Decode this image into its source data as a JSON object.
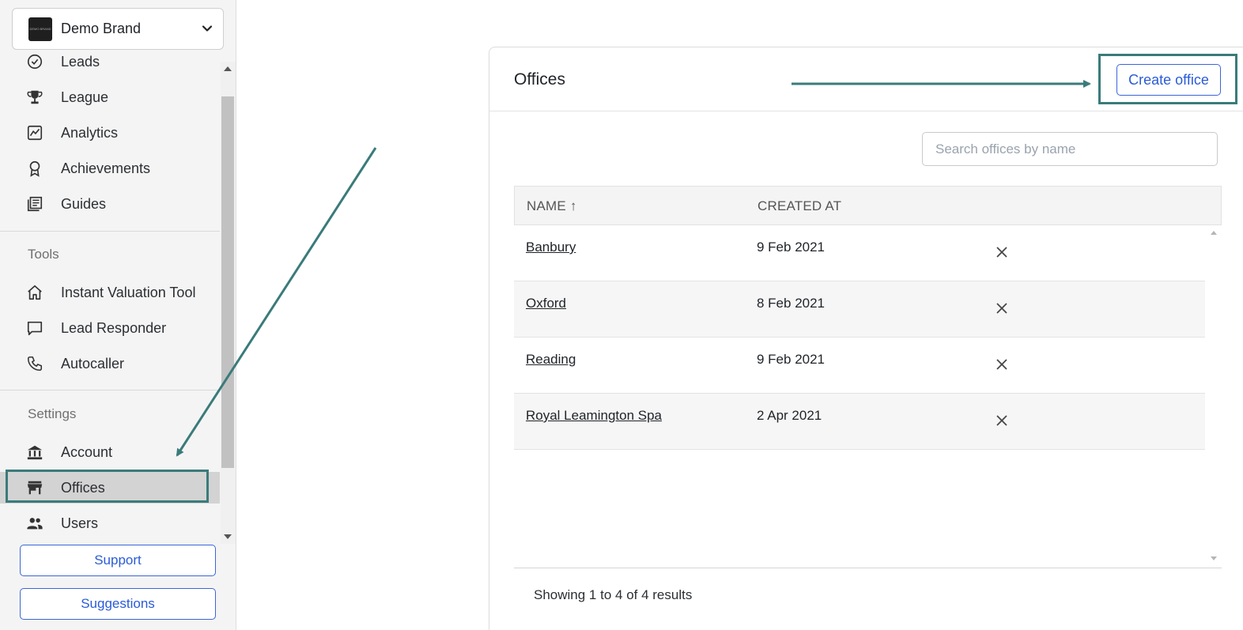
{
  "brand": {
    "name": "Demo Brand",
    "logo_text": "DEMO BRAND"
  },
  "sidebar": {
    "items_top": [
      {
        "label": "Leads",
        "icon": "leads-icon"
      },
      {
        "label": "League",
        "icon": "trophy-icon"
      },
      {
        "label": "Analytics",
        "icon": "analytics-icon"
      },
      {
        "label": "Achievements",
        "icon": "award-icon"
      },
      {
        "label": "Guides",
        "icon": "guides-icon"
      }
    ],
    "tools_label": "Tools",
    "tools": [
      {
        "label": "Instant Valuation Tool",
        "icon": "home-icon"
      },
      {
        "label": "Lead Responder",
        "icon": "chat-icon"
      },
      {
        "label": "Autocaller",
        "icon": "phone-icon"
      }
    ],
    "settings_label": "Settings",
    "settings": [
      {
        "label": "Account",
        "icon": "bank-icon"
      },
      {
        "label": "Offices",
        "icon": "store-icon"
      },
      {
        "label": "Users",
        "icon": "users-icon"
      }
    ],
    "support_label": "Support",
    "suggestions_label": "Suggestions"
  },
  "main": {
    "title": "Offices",
    "create_label": "Create office",
    "search_placeholder": "Search offices by name",
    "columns": {
      "name": "NAME ↑",
      "created": "CREATED AT"
    },
    "rows": [
      {
        "name": "Banbury",
        "created": "9 Feb 2021"
      },
      {
        "name": "Oxford",
        "created": "8 Feb 2021"
      },
      {
        "name": "Reading",
        "created": "9 Feb 2021"
      },
      {
        "name": "Royal Leamington Spa",
        "created": "2 Apr 2021"
      }
    ],
    "footer": "Showing 1 to 4 of 4 results"
  },
  "colors": {
    "accent": "#2a5bd7",
    "annotation": "#3a7b7a",
    "active_bg": "#d3d3d3"
  }
}
